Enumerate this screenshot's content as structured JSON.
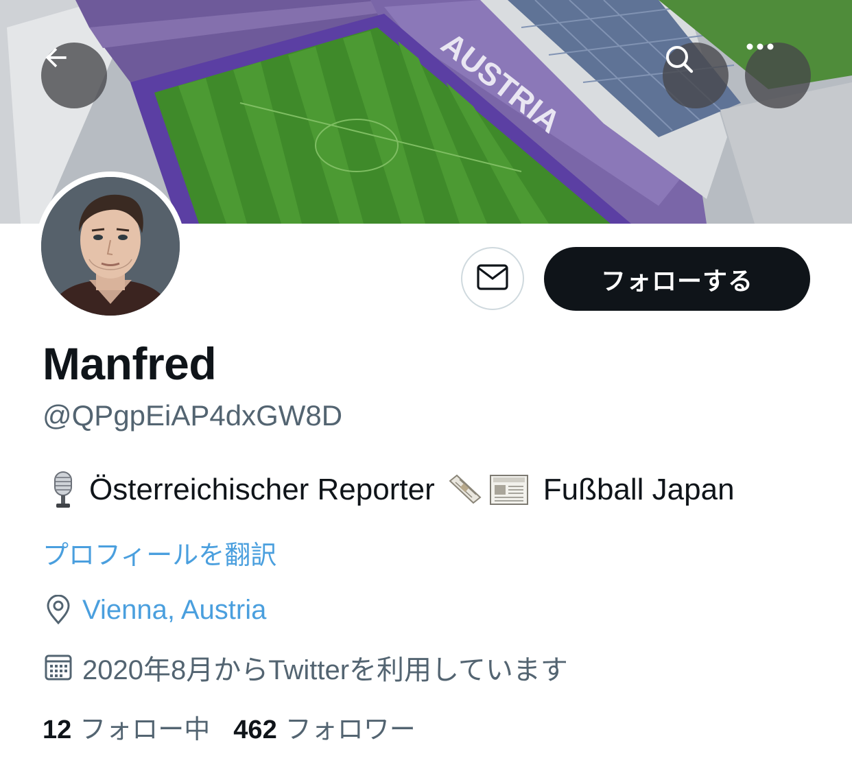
{
  "banner": {
    "stadium_text": "AUSTRIA"
  },
  "header_buttons": {
    "back_icon": "arrow-left-icon",
    "search_icon": "search-icon",
    "more_icon": "more-horizontal-icon"
  },
  "actions": {
    "message_icon": "envelope-icon",
    "follow_label": "フォローする"
  },
  "profile": {
    "display_name": "Manfred",
    "handle": "@QPgpEiAP4dxGW8D",
    "bio": {
      "leading_emoji": "microphone-icon",
      "text": "Österreichischer Reporter",
      "emoji_2": "rolled-newspaper-icon",
      "emoji_3": "newspaper-icon",
      "trailing_text": "Fußball Japan"
    },
    "translate_link": "プロフィールを翻訳",
    "location": "Vienna, Austria",
    "joined": "2020年8月からTwitterを利用しています"
  },
  "stats": {
    "following_count": "12",
    "following_label": "フォロー中",
    "followers_count": "462",
    "followers_label": "フォロワー"
  },
  "colors": {
    "accent_link": "#4a9fde",
    "primary_text": "#0f1419",
    "secondary_text": "#536471",
    "follow_button_bg": "#0f1419"
  }
}
